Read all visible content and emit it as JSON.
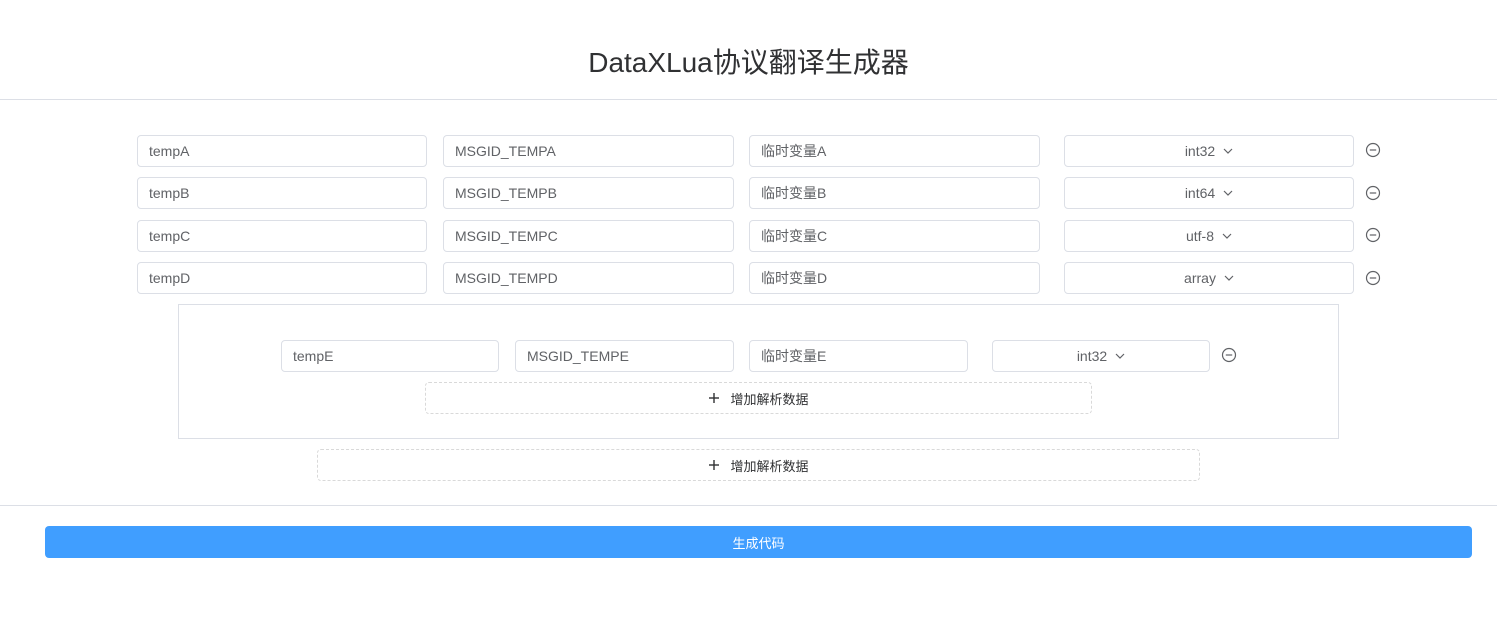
{
  "header": {
    "title": "DataXLua协议翻译生成器"
  },
  "rows": [
    {
      "name": "tempA",
      "msgid": "MSGID_TEMPA",
      "desc": "临时变量A",
      "type": "int32"
    },
    {
      "name": "tempB",
      "msgid": "MSGID_TEMPB",
      "desc": "临时变量B",
      "type": "int64"
    },
    {
      "name": "tempC",
      "msgid": "MSGID_TEMPC",
      "desc": "临时变量C",
      "type": "utf-8"
    },
    {
      "name": "tempD",
      "msgid": "MSGID_TEMPD",
      "desc": "临时变量D",
      "type": "array"
    }
  ],
  "nested": {
    "rows": [
      {
        "name": "tempE",
        "msgid": "MSGID_TEMPE",
        "desc": "临时变量E",
        "type": "int32"
      }
    ],
    "add_label": "增加解析数据"
  },
  "add_label": "增加解析数据",
  "generate_label": "生成代码",
  "icons": {
    "remove": "minus-circle-icon",
    "dropdown": "chevron-down-icon",
    "add": "plus-icon"
  },
  "colors": {
    "primary": "#409eff",
    "border": "#dcdfe6",
    "text": "#606266",
    "title": "#303133"
  }
}
